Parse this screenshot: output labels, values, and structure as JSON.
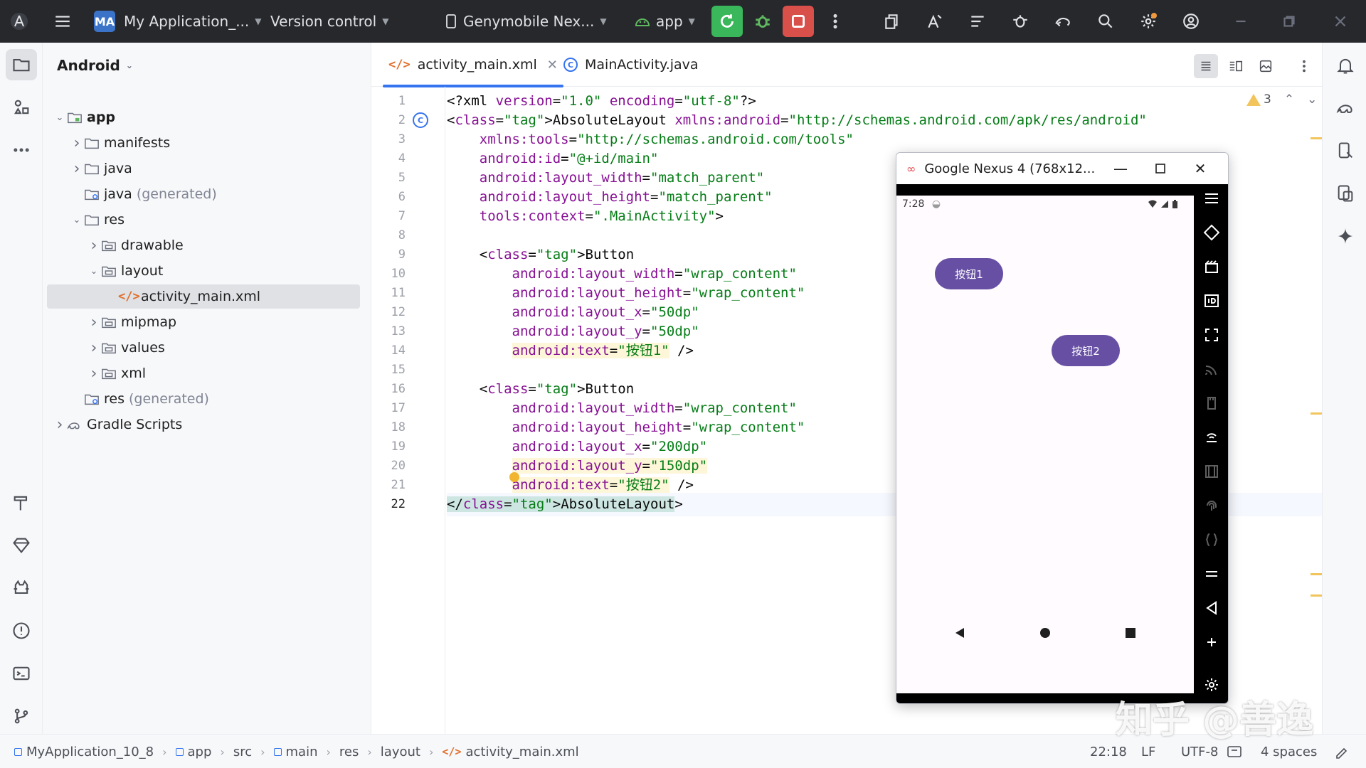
{
  "titlebar": {
    "project_badge": "MA",
    "project_name": "My Application_...",
    "vcs_label": "Version control",
    "device_name": "Genymobile Nex...",
    "run_config": "app"
  },
  "project_panel": {
    "view_label": "Android",
    "tree": [
      {
        "label": "app",
        "indent": 0,
        "arrow": "v",
        "icon": "module"
      },
      {
        "label": "manifests",
        "indent": 1,
        "arrow": ">",
        "icon": "folder"
      },
      {
        "label": "java",
        "indent": 1,
        "arrow": ">",
        "icon": "folder"
      },
      {
        "label": "java",
        "suffix": "(generated)",
        "indent": 1,
        "arrow": "",
        "icon": "folder-gen"
      },
      {
        "label": "res",
        "indent": 1,
        "arrow": "v",
        "icon": "folder"
      },
      {
        "label": "drawable",
        "indent": 2,
        "arrow": ">",
        "icon": "folder-res"
      },
      {
        "label": "layout",
        "indent": 2,
        "arrow": "v",
        "icon": "folder-res"
      },
      {
        "label": "activity_main.xml",
        "indent": 3,
        "arrow": "",
        "icon": "xml",
        "selected": true
      },
      {
        "label": "mipmap",
        "indent": 2,
        "arrow": ">",
        "icon": "folder-res"
      },
      {
        "label": "values",
        "indent": 2,
        "arrow": ">",
        "icon": "folder-res"
      },
      {
        "label": "xml",
        "indent": 2,
        "arrow": ">",
        "icon": "folder-res"
      },
      {
        "label": "res",
        "suffix": "(generated)",
        "indent": 1,
        "arrow": "",
        "icon": "folder-gen"
      },
      {
        "label": "Gradle Scripts",
        "indent": 0,
        "arrow": ">",
        "icon": "gradle"
      }
    ]
  },
  "editor": {
    "tabs": [
      {
        "label": "activity_main.xml",
        "active": true
      },
      {
        "label": "MainActivity.java",
        "active": false
      }
    ],
    "warning_count": "3",
    "current_line": 22,
    "lines": [
      "<?xml version=\"1.0\" encoding=\"utf-8\"?>",
      "<AbsoluteLayout xmlns:android=\"http://schemas.android.com/apk/res/android\"",
      "    xmlns:tools=\"http://schemas.android.com/tools\"",
      "    android:id=\"@+id/main\"",
      "    android:layout_width=\"match_parent\"",
      "    android:layout_height=\"match_parent\"",
      "    tools:context=\".MainActivity\">",
      "",
      "    <Button",
      "        android:layout_width=\"wrap_content\"",
      "        android:layout_height=\"wrap_content\"",
      "        android:layout_x=\"50dp\"",
      "        android:layout_y=\"50dp\"",
      "        android:text=\"按钮1\" />",
      "",
      "    <Button",
      "        android:layout_width=\"wrap_content\"",
      "        android:layout_height=\"wrap_content\"",
      "        android:layout_x=\"200dp\"",
      "        android:layout_y=\"150dp\"",
      "        android:text=\"按钮2\" />",
      "</AbsoluteLayout>"
    ]
  },
  "emulator": {
    "title": "Google Nexus 4 (768x12...",
    "time": "7:28",
    "button1": "按钮1",
    "button2": "按钮2"
  },
  "statusbar": {
    "breadcrumbs": [
      "MyApplication_10_8",
      "app",
      "src",
      "main",
      "res",
      "layout",
      "activity_main.xml"
    ],
    "position": "22:18",
    "line_sep": "LF",
    "encoding": "UTF-8",
    "indent": "4 spaces"
  },
  "watermark": "知乎 @善逸",
  "colors": {
    "accent": "#3574f0",
    "run_green": "#3ab65b",
    "stop_red": "#d9504b",
    "phone_button": "#6750a4"
  }
}
